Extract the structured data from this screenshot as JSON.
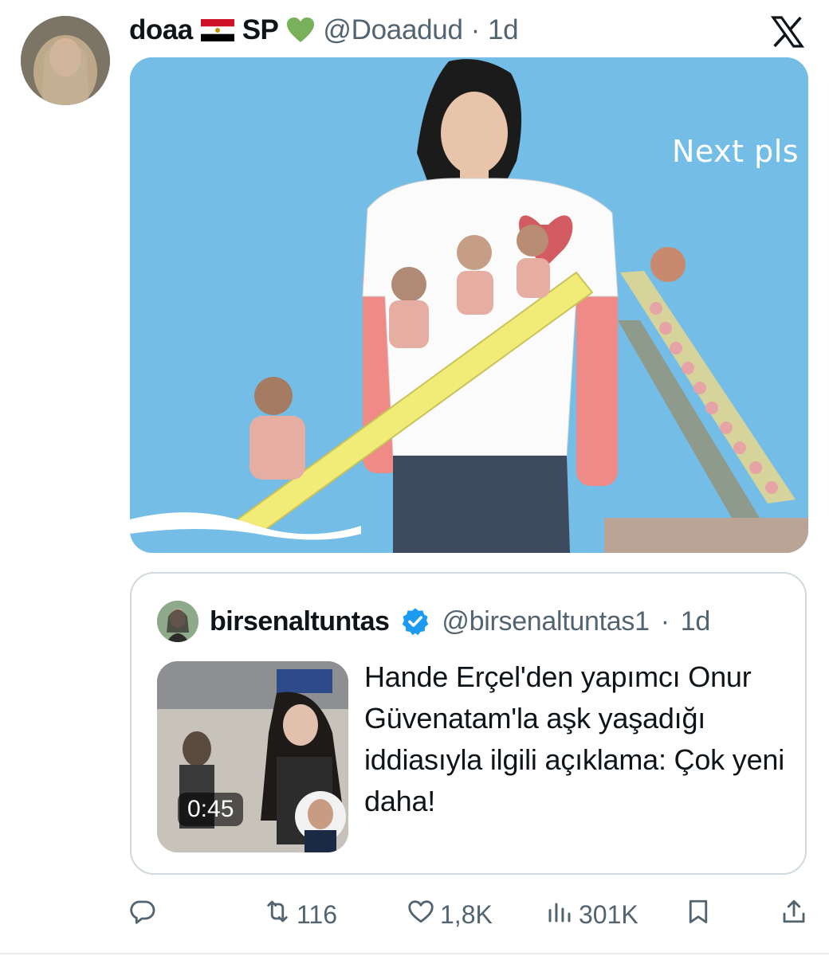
{
  "tweet": {
    "display_name": "doaa",
    "display_suffix": "SP",
    "handle": "@Doaadud",
    "separator": "·",
    "time": "1d",
    "image_caption": "Next pls"
  },
  "quoted_tweet": {
    "display_name": "birsenaltuntas",
    "handle": "@birsenaltuntas1",
    "separator": "·",
    "time": "1d",
    "video_duration": "0:45",
    "text": "Hande Erçel'den yapımcı Onur Güvenatam'la aşk yaşadığı iddiasıyla ilgili açıklama: Çok yeni daha!"
  },
  "actions": {
    "reply_count": "",
    "retweet_count": "116",
    "like_count": "1,8K",
    "view_count": "301K"
  },
  "icons": {
    "flag": "egypt-flag-icon",
    "heart": "green-heart-icon",
    "brand": "x-logo-icon",
    "verified": "verified-badge-icon",
    "reply": "reply-icon",
    "retweet": "retweet-icon",
    "like": "like-icon",
    "views": "views-icon",
    "bookmark": "bookmark-icon",
    "share": "share-icon"
  },
  "colors": {
    "text": "#0f1419",
    "secondary": "#536471",
    "verified": "#1d9bf0",
    "border": "#cfd9de"
  }
}
